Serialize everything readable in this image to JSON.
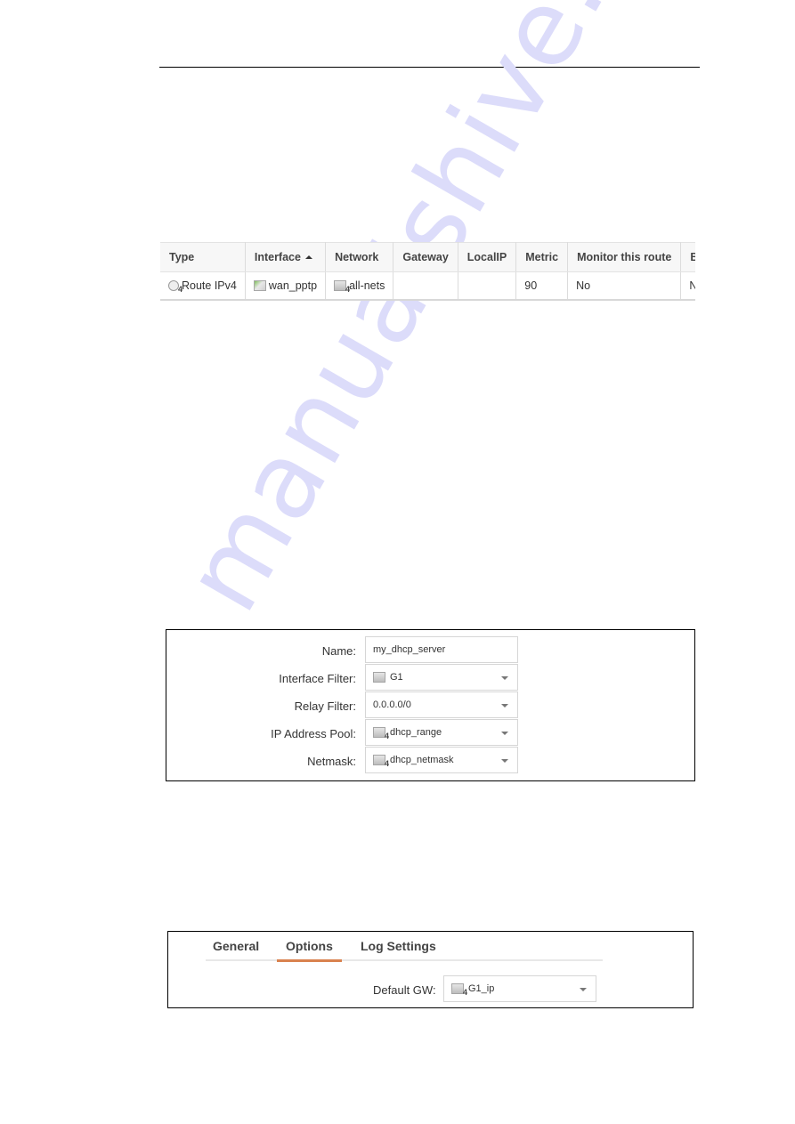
{
  "watermark": "manualshive.com",
  "route_table": {
    "columns": [
      "Type",
      "Interface",
      "Network",
      "Gateway",
      "LocalIP",
      "Metric",
      "Monitor this route",
      "Broadcast"
    ],
    "sorted_column": "Interface",
    "sort_direction": "ascending",
    "rows": [
      {
        "type": "Route IPv4",
        "type_icon": "route-ipv4-icon",
        "interface": "wan_pptp",
        "interface_icon": "interface-icon",
        "network": "all-nets",
        "network_icon": "ipv4-address-icon",
        "gateway": "",
        "localip": "",
        "metric": "90",
        "monitor": "No",
        "broadcast": "No"
      }
    ]
  },
  "dhcp_form": {
    "fields": [
      {
        "label": "Name:",
        "value": "my_dhcp_server",
        "kind": "text"
      },
      {
        "label": "Interface Filter:",
        "value": "G1",
        "kind": "dropdown",
        "icon": "interface-icon"
      },
      {
        "label": "Relay Filter:",
        "value": "0.0.0.0/0",
        "kind": "dropdown"
      },
      {
        "label": "IP Address Pool:",
        "value": "dhcp_range",
        "kind": "dropdown",
        "icon": "ipv4-address-icon"
      },
      {
        "label": "Netmask:",
        "value": "dhcp_netmask",
        "kind": "dropdown",
        "icon": "ipv4-address-icon"
      }
    ]
  },
  "options_form": {
    "tabs": [
      {
        "label": "General",
        "active": false
      },
      {
        "label": "Options",
        "active": true
      },
      {
        "label": "Log Settings",
        "active": false
      }
    ],
    "default_gw": {
      "label": "Default GW:",
      "value": "G1_ip",
      "icon": "ipv4-address-icon"
    }
  },
  "colors": {
    "active_tab_underline": "#d9824f",
    "watermark": "#dcdcfa"
  }
}
